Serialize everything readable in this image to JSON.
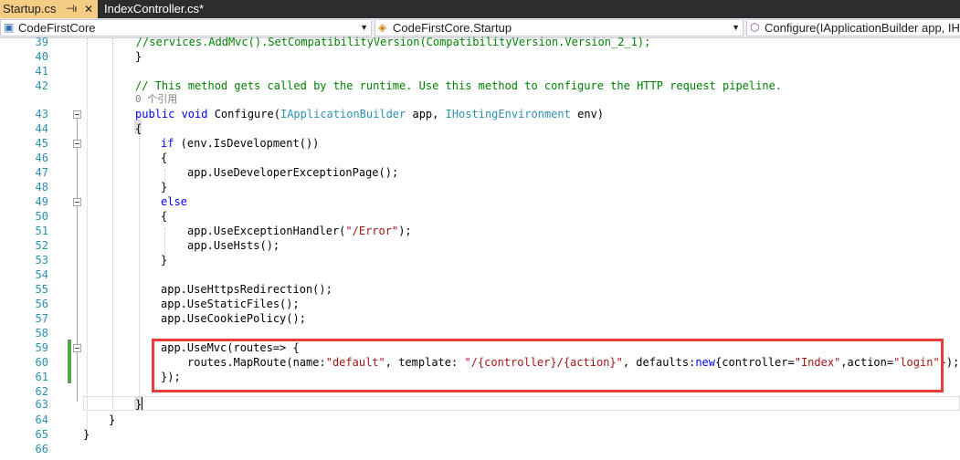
{
  "tabs": [
    {
      "title": "Startup.cs",
      "pin": "⊣ᵻ",
      "close": "✕",
      "active": true
    },
    {
      "title": "IndexController.cs*",
      "active": false
    }
  ],
  "navbar": {
    "project": "CodeFirstCore",
    "type": "CodeFirstCore.Startup",
    "member": "Configure(IApplicationBuilder app, IHostingEnvironment env)"
  },
  "icons": {
    "project": "csharp-project-icon",
    "type": "class-icon",
    "member": "method-icon",
    "dropdown": "chevron-down-icon"
  },
  "code_lens": "0 个引用",
  "lines": {
    "n39": "39",
    "n40": "40",
    "n41": "41",
    "n42": "42",
    "n43": "43",
    "n44": "44",
    "n45": "45",
    "n46": "46",
    "n47": "47",
    "n48": "48",
    "n49": "49",
    "n50": "50",
    "n51": "51",
    "n52": "52",
    "n53": "53",
    "n54": "54",
    "n55": "55",
    "n56": "56",
    "n57": "57",
    "n58": "58",
    "n59": "59",
    "n60": "60",
    "n61": "61",
    "n62": "62",
    "n63": "63",
    "n64": "64",
    "n65": "65",
    "n66": "66"
  },
  "code": {
    "l39": "        //services.AddMvc().SetCompatibilityVersion(CompatibilityVersion.Version_2_1);",
    "l40": "}",
    "l42": "// This method gets called by the runtime. Use this method to configure the HTTP request pipeline.",
    "l43_kw": "public void",
    "l43_name": " Configure(",
    "l43_t1": "IApplicationBuilder",
    "l43_p1": " app, ",
    "l43_t2": "IHostingEnvironment",
    "l43_p2": " env)",
    "l44": "{",
    "l45_kw": "if",
    "l45_rest": " (env.IsDevelopment())",
    "l46": "{",
    "l47": "app.UseDeveloperExceptionPage();",
    "l48": "}",
    "l49": "else",
    "l50": "{",
    "l51_a": "app.UseExceptionHandler(",
    "l51_s": "\"/Error\"",
    "l51_b": ");",
    "l52": "app.UseHsts();",
    "l53": "}",
    "l55": "app.UseHttpsRedirection();",
    "l56": "app.UseStaticFiles();",
    "l57": "app.UseCookiePolicy();",
    "l59": "app.UseMvc(routes=> {",
    "l60_a": "routes.MapRoute(name:",
    "l60_s1": "\"default\"",
    "l60_b": ", template: ",
    "l60_s2": "\"/{controller}/{action}\"",
    "l60_c": ", defaults:",
    "l60_kw": "new",
    "l60_d": "{controller=",
    "l60_s3": "\"Index\"",
    "l60_e": ",action=",
    "l60_s4": "\"login\"",
    "l60_f": "});",
    "l61": "});",
    "l63": "}",
    "l64": "}",
    "l65": "}"
  }
}
